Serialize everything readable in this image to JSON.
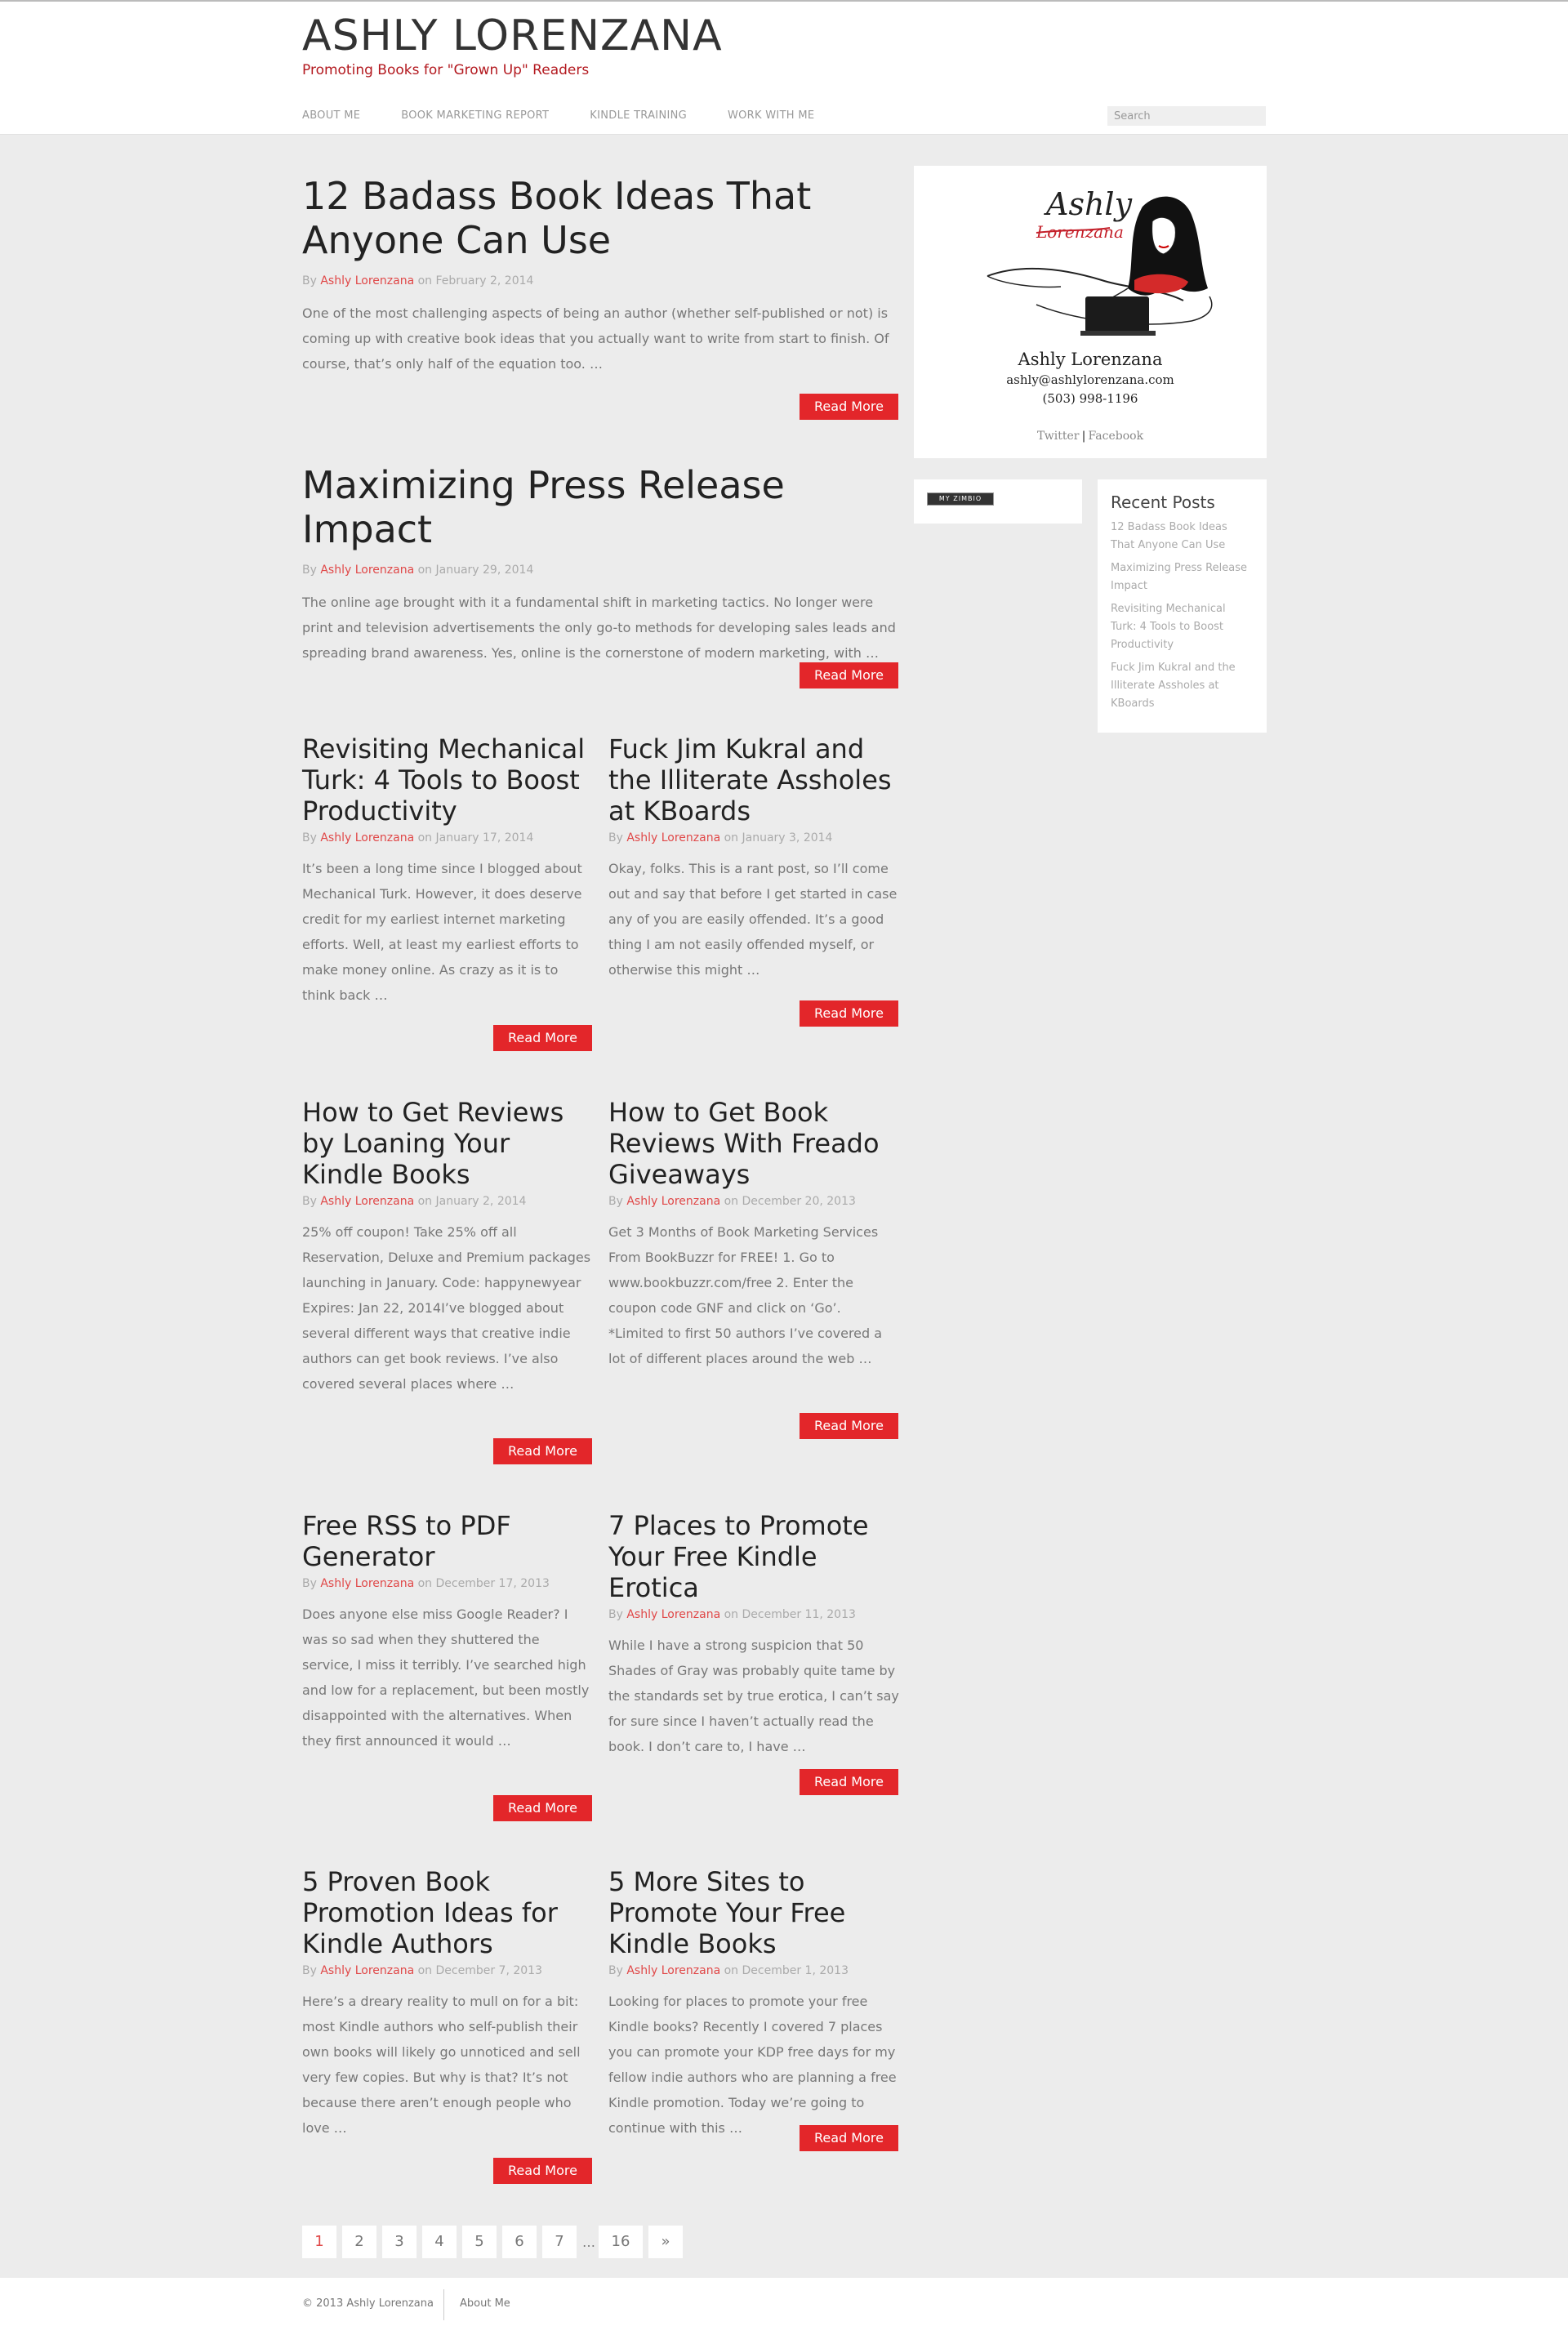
{
  "site": {
    "title": "ASHLY LORENZANA",
    "tagline": "Promoting Books for \"Grown Up\" Readers"
  },
  "nav": {
    "items": [
      "ABOUT ME",
      "BOOK MARKETING REPORT",
      "KINDLE TRAINING",
      "WORK WITH ME"
    ],
    "search_placeholder": "Search"
  },
  "posts": [
    {
      "title": "12 Badass Book Ideas That Anyone Can Use",
      "by": "By ",
      "author": "Ashly Lorenzana",
      "date": " on February 2, 2014",
      "excerpt": "One of the most challenging aspects of being an author (whether self-published or not) is coming up with creative book ideas that you actually want to write from start to finish. Of course, that’s only half of the equation too. …",
      "read_more": "Read More"
    },
    {
      "title": "Maximizing Press Release Impact",
      "by": "By ",
      "author": "Ashly Lorenzana",
      "date": " on January 29, 2014",
      "excerpt": "The online age brought with it a fundamental shift in marketing tactics. No longer were print and television advertisements the only go-to methods for developing sales leads and spreading brand awareness. Yes, online is the cornerstone of modern marketing, with …",
      "read_more": "Read More"
    },
    {
      "title": "Revisiting Mechanical Turk: 4 Tools to Boost Productivity",
      "by": "By ",
      "author": "Ashly Lorenzana",
      "date": " on January 17, 2014",
      "excerpt": "It’s been a long time since I blogged about Mechanical Turk. However, it does deserve credit for my earliest internet marketing efforts. Well, at least my earliest efforts to make money online. As crazy as it is to think back …",
      "read_more": "Read More"
    },
    {
      "title": "Fuck Jim Kukral and the Illiterate Assholes at KBoards",
      "by": "By ",
      "author": "Ashly Lorenzana",
      "date": " on January 3, 2014",
      "excerpt": "Okay, folks. This is a rant post, so I’ll come out and say that before I get started in case any of you are easily offended. It’s a good thing I am not easily offended myself, or otherwise this might …",
      "read_more": "Read More"
    },
    {
      "title": "How to Get Reviews by Loaning Your Kindle Books",
      "by": "By ",
      "author": "Ashly Lorenzana",
      "date": " on January 2, 2014",
      "excerpt": "25% off coupon! Take 25% off all Reservation, Deluxe and Premium packages launching in January. Code: happynewyear Expires: Jan 22, 2014I’ve blogged about several different ways that creative indie authors can get book reviews. I’ve also covered several places where …",
      "read_more": "Read More"
    },
    {
      "title": "How to Get Book Reviews With Freado Giveaways",
      "by": "By ",
      "author": "Ashly Lorenzana",
      "date": " on December 20, 2013",
      "excerpt": "Get 3 Months of Book Marketing Services From BookBuzzr for FREE! 1. Go to www.bookbuzzr.com/free 2. Enter the coupon code GNF and click on ‘Go’. *Limited to first 50 authors I’ve covered a lot of different places around the web …",
      "read_more": "Read More"
    },
    {
      "title": "Free RSS to PDF Generator",
      "by": "By ",
      "author": "Ashly Lorenzana",
      "date": " on December 17, 2013",
      "excerpt": "Does anyone else miss Google Reader? I was so sad when they shuttered the service, I miss it terribly. I’ve searched high and low for a replacement, but been mostly disappointed with the alternatives. When they first announced it would …",
      "read_more": "Read More"
    },
    {
      "title": "7 Places to Promote Your Free Kindle Erotica",
      "by": "By ",
      "author": "Ashly Lorenzana",
      "date": " on December 11, 2013",
      "excerpt": "While I have a strong suspicion that 50 Shades of Gray was probably quite tame by the standards set by true erotica, I can’t say for sure since I haven’t actually read the book. I don’t care to, I have …",
      "read_more": "Read More"
    },
    {
      "title": "5 Proven Book Promotion Ideas for Kindle Authors",
      "by": "By ",
      "author": "Ashly Lorenzana",
      "date": " on December 7, 2013",
      "excerpt": "Here’s a dreary reality to mull on for a bit: most Kindle authors who self-publish their own books will likely go unnoticed and sell very few copies. But why is that? It’s not because there aren’t enough people who love …",
      "read_more": "Read More"
    },
    {
      "title": "5 More Sites to Promote Your Free Kindle Books",
      "by": "By ",
      "author": "Ashly Lorenzana",
      "date": " on December 1, 2013",
      "excerpt": "Looking for places to promote your free Kindle books? Recently I covered 7 places you can promote your KDP free days for my fellow indie authors who are planning a free Kindle promotion. Today we’re going to continue with this …",
      "read_more": "Read More"
    }
  ],
  "profile": {
    "logo_first": "Ashly",
    "logo_last": "Lorenzana",
    "name": "Ashly Lorenzana",
    "email": "ashly@ashlylorenzana.com",
    "phone": "(503) 998-1196",
    "twitter": "Twitter",
    "facebook": "Facebook",
    "separator": "|"
  },
  "badge": {
    "label": "MY ZIMBIO"
  },
  "recent_posts": {
    "title": "Recent Posts",
    "items": [
      "12 Badass Book Ideas That Anyone Can Use",
      "Maximizing Press Release Impact",
      "Revisiting Mechanical Turk: 4 Tools to Boost Productivity",
      "Fuck Jim Kukral and the Illiterate Assholes at KBoards"
    ]
  },
  "pagination": {
    "pages": [
      "1",
      "2",
      "3",
      "4",
      "5",
      "6",
      "7"
    ],
    "dots": "…",
    "last": "16",
    "next": "»"
  },
  "footer": {
    "copyright": "© 2013 Ashly Lorenzana",
    "link": "About Me"
  },
  "colors": {
    "accent": "#e3262a",
    "tagline": "#b3191f",
    "background": "#ececec"
  }
}
